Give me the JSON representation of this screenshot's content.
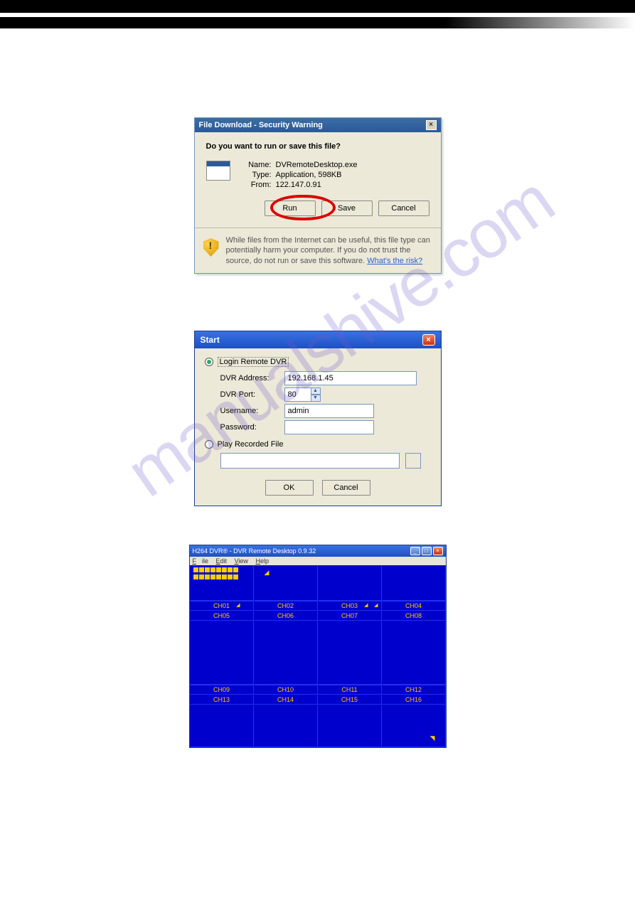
{
  "dlg1": {
    "title": "File Download - Security Warning",
    "question": "Do you want to run or save this file?",
    "name_lbl": "Name:",
    "type_lbl": "Type:",
    "from_lbl": "From:",
    "name_val": "DVRemoteDesktop.exe",
    "type_val": "Application, 598KB",
    "from_val": "122.147.0.91",
    "run": "Run",
    "save": "Save",
    "cancel": "Cancel",
    "warn1": "While files from the Internet can be useful, this file type can potentially harm your computer. If you do not trust the source, do not run or save this software. ",
    "warn_link": "What's the risk?"
  },
  "dlg2": {
    "title": "Start",
    "radio1": "Login Remote DVR",
    "addr_lbl": "DVR Address:",
    "addr_val": "192.168.1.45",
    "port_lbl": "DVR Port:",
    "port_val": "80",
    "user_lbl": "Username:",
    "user_val": "admin",
    "pass_lbl": "Password:",
    "pass_val": "",
    "radio2": "Play Recorded File",
    "ok": "OK",
    "cancel": "Cancel"
  },
  "dlg3": {
    "title": "H264 DVR® - DVR Remote Desktop 0.9.32",
    "menu_file": "File",
    "menu_edit": "Edit",
    "menu_view": "View",
    "menu_help": "Help",
    "ch": [
      "CH01",
      "CH02",
      "CH03",
      "CH04",
      "CH05",
      "CH06",
      "CH07",
      "CH08",
      "CH09",
      "CH10",
      "CH11",
      "CH12",
      "CH13",
      "CH14",
      "CH15",
      "CH16"
    ]
  },
  "watermark": "manualshive.com"
}
